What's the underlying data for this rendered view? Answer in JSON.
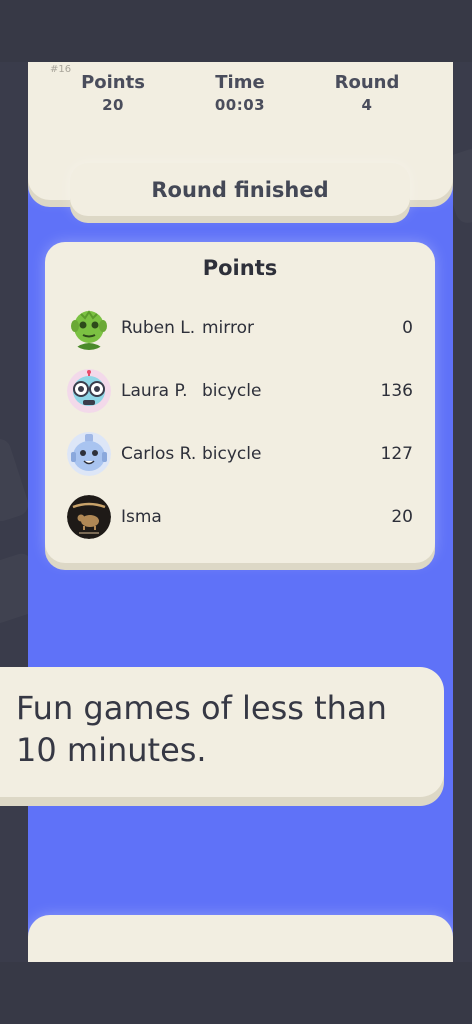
{
  "game": {
    "id": "#16",
    "stats": [
      {
        "label": "Points",
        "value": "20"
      },
      {
        "label": "Time",
        "value": "00:03"
      },
      {
        "label": "Round",
        "value": "4"
      }
    ]
  },
  "banner": {
    "text": "Round finished"
  },
  "points": {
    "title": "Points",
    "players": [
      {
        "name": "Ruben L.",
        "word": "mirror",
        "score": "0",
        "avatar": "green-alien-avatar"
      },
      {
        "name": "Laura P.",
        "word": "bicycle",
        "score": "136",
        "avatar": "robot-goggles-avatar"
      },
      {
        "name": "Carlos R.",
        "word": "bicycle",
        "score": "127",
        "avatar": "blue-robot-avatar"
      },
      {
        "name": "Isma",
        "word": "",
        "score": "20",
        "avatar": "dark-logo-avatar"
      }
    ]
  },
  "promo": {
    "text": "Fun games of less than 10 minutes."
  },
  "colors": {
    "background": "#3a3c4b",
    "game_panel": "#5f72f8",
    "card": "#f2eee1",
    "text_dark": "#2e303a"
  }
}
